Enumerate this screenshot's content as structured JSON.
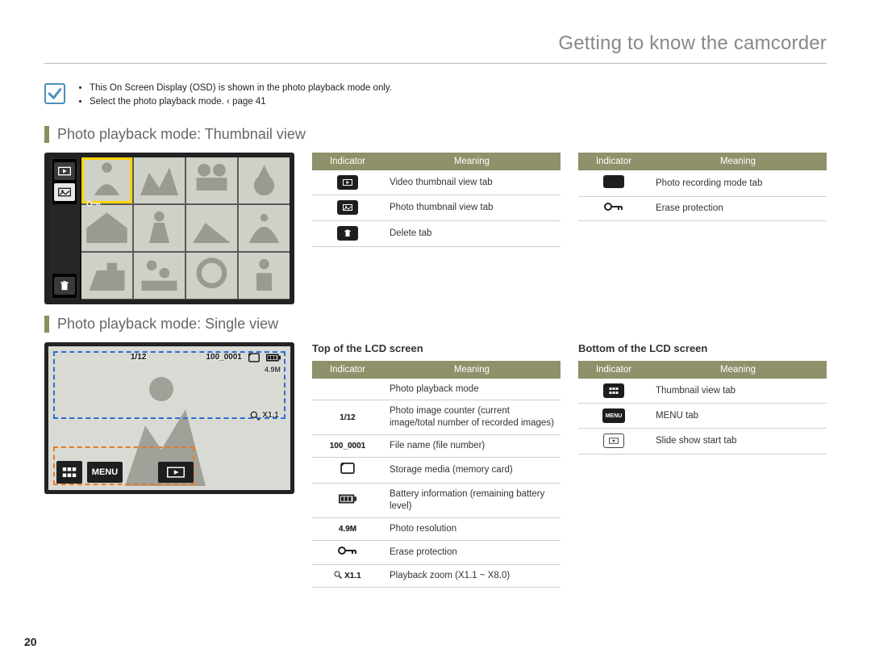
{
  "chapter_title": "Getting to know the camcorder",
  "page_number": "20",
  "notes": [
    "This On Screen Display (OSD) is shown in the photo playback mode only.",
    "Select the photo playback mode.  ‹ page 41"
  ],
  "section1": {
    "heading": "Photo playback mode: Thumbnail view"
  },
  "section2": {
    "heading": "Photo playback mode: Single view"
  },
  "table_headers": {
    "indicator": "Indicator",
    "meaning": "Meaning"
  },
  "thumb_table_left": [
    {
      "icon": "video-thumb-tab",
      "meaning": "Video thumbnail view tab"
    },
    {
      "icon": "photo-thumb-tab",
      "meaning": "Photo thumbnail view tab"
    },
    {
      "icon": "delete-tab",
      "meaning": "Delete tab"
    }
  ],
  "thumb_table_right": [
    {
      "icon": "photo-rec-tab",
      "meaning": "Photo recording mode tab"
    },
    {
      "icon": "erase-protect",
      "meaning": "Erase protection"
    }
  ],
  "single": {
    "top_heading": "Top of the LCD screen",
    "bottom_heading": "Bottom of the LCD screen",
    "osd": {
      "counter": "1/12",
      "file_name": "100_0001",
      "resolution": "4.9M",
      "zoom": "X1.1"
    },
    "menu_label": "MENU"
  },
  "top_table": [
    {
      "icon": "photo-play-mode",
      "label": "",
      "meaning": "Photo playback mode"
    },
    {
      "icon": "text",
      "label": "1/12",
      "meaning": "Photo image counter (current image/total number of recorded images)"
    },
    {
      "icon": "text",
      "label": "100_0001",
      "meaning": "File name (file number)"
    },
    {
      "icon": "card",
      "label": "",
      "meaning": "Storage media (memory card)"
    },
    {
      "icon": "battery",
      "label": "",
      "meaning": "Battery information (remaining battery level)"
    },
    {
      "icon": "text",
      "label": "4.9M",
      "meaning": "Photo resolution"
    },
    {
      "icon": "erase-protect",
      "label": "",
      "meaning": "Erase protection"
    },
    {
      "icon": "zoom",
      "label": "X1.1",
      "meaning": "Playback zoom (X1.1 ~ X8.0)"
    }
  ],
  "bottom_table": [
    {
      "icon": "thumb-view-tab",
      "meaning": "Thumbnail view tab"
    },
    {
      "icon": "menu-tab",
      "label": "MENU",
      "meaning": "MENU tab"
    },
    {
      "icon": "slideshow-tab",
      "meaning": "Slide show start tab"
    }
  ]
}
